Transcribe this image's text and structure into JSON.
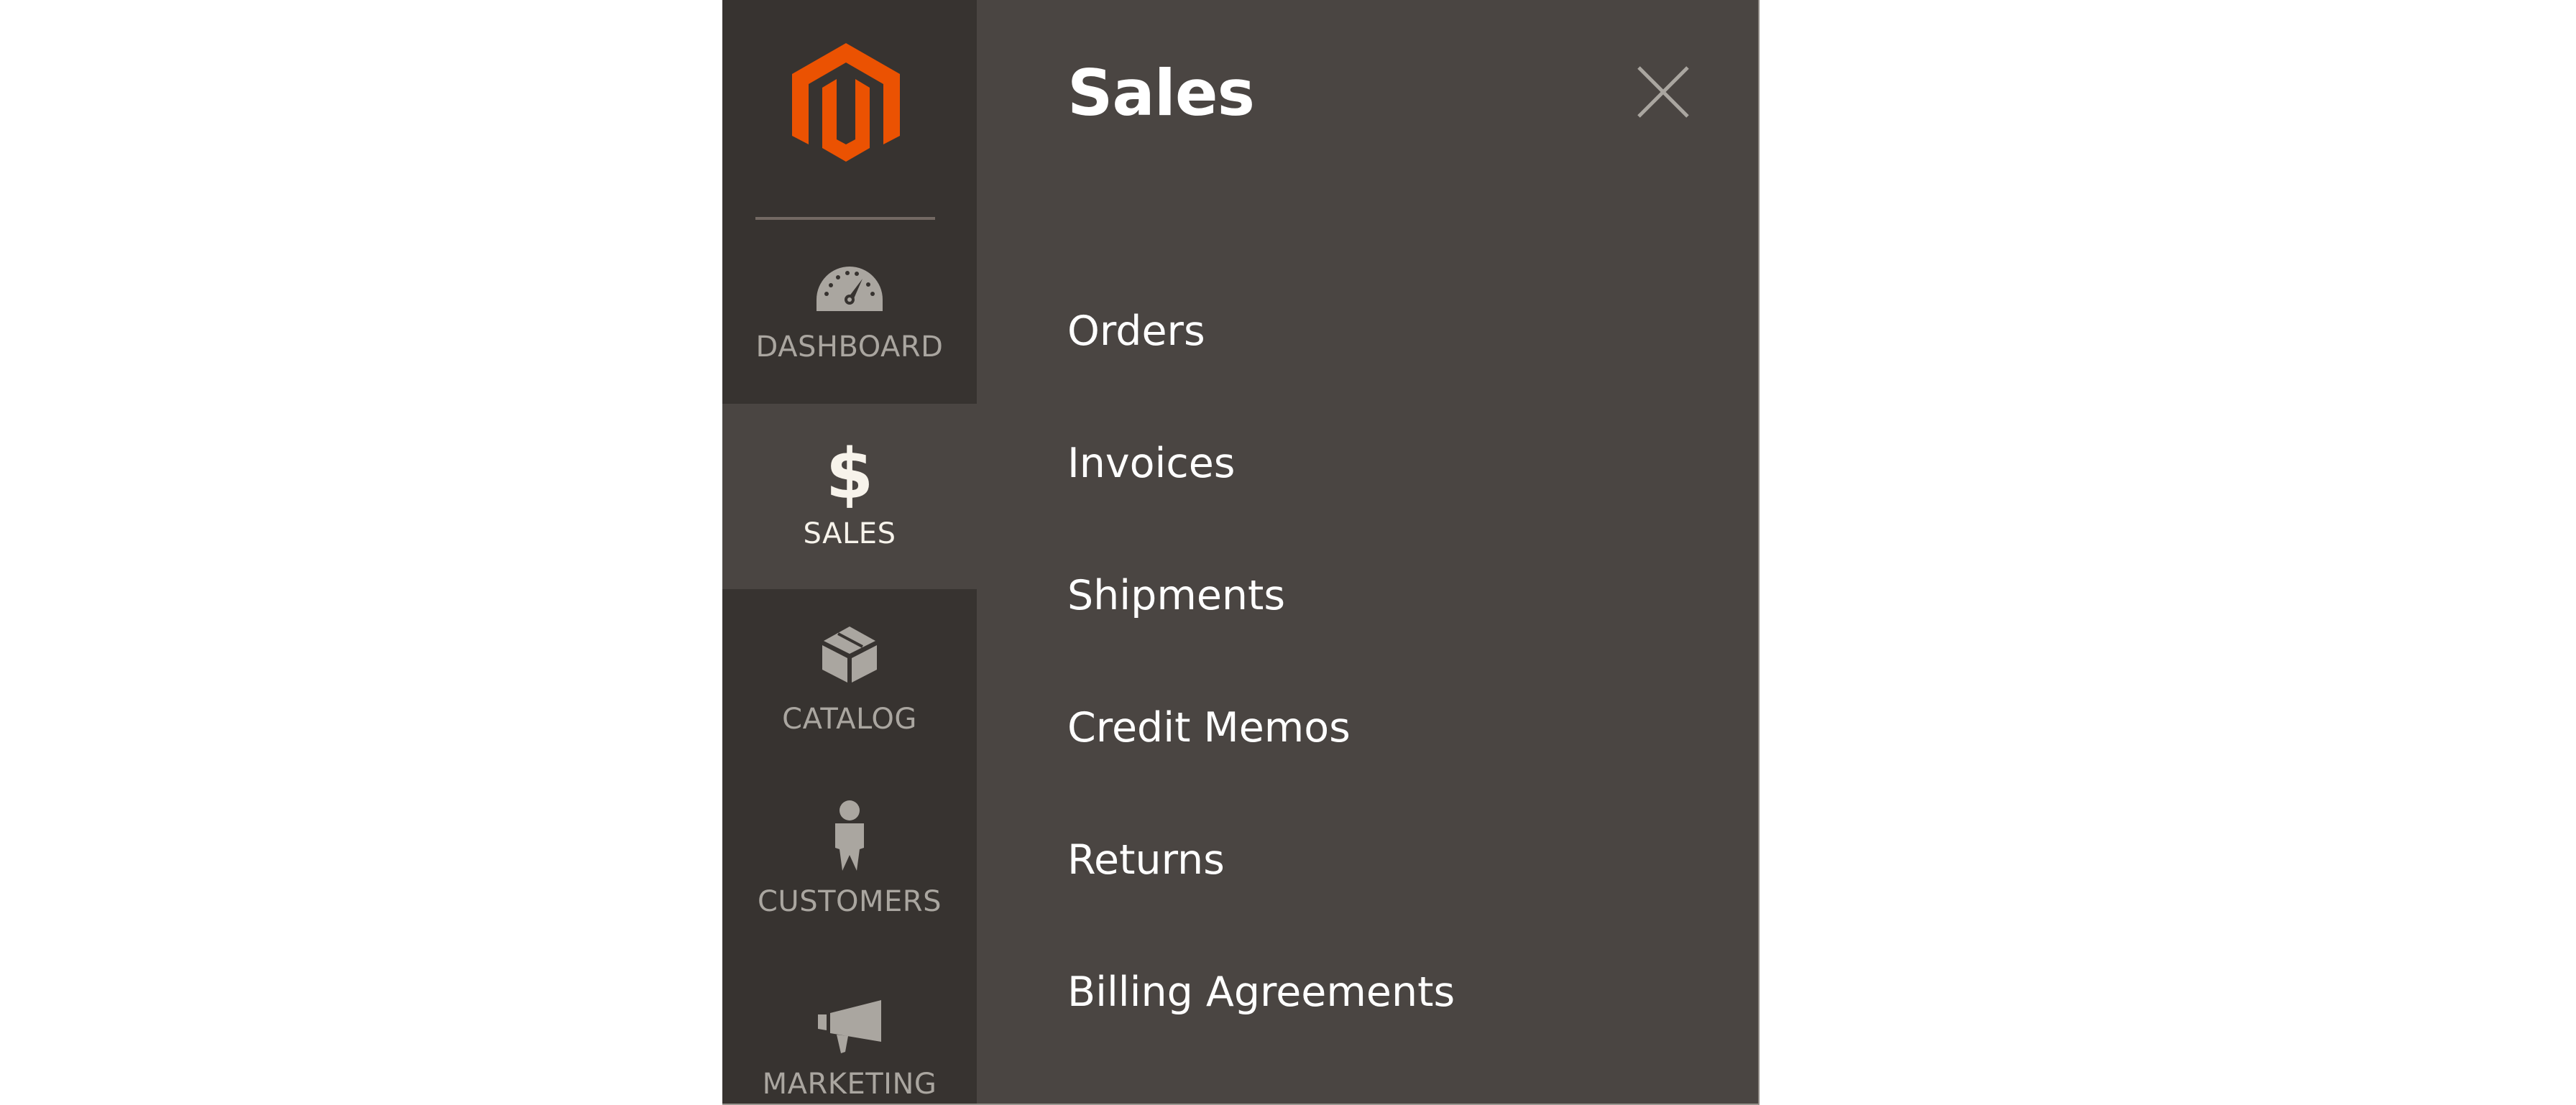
{
  "brand": {
    "logo": "magento-logo",
    "accent_color": "#eb5202"
  },
  "sidebar": {
    "items": [
      {
        "label": "DASHBOARD",
        "icon": "dashboard-gauge-icon",
        "active": false
      },
      {
        "label": "SALES",
        "icon": "dollar-icon",
        "active": true
      },
      {
        "label": "CATALOG",
        "icon": "box-icon",
        "active": false
      },
      {
        "label": "CUSTOMERS",
        "icon": "person-icon",
        "active": false
      },
      {
        "label": "MARKETING",
        "icon": "megaphone-icon",
        "active": false
      }
    ]
  },
  "panel": {
    "title": "Sales",
    "close_icon": "close-icon",
    "items": [
      {
        "label": "Orders"
      },
      {
        "label": "Invoices"
      },
      {
        "label": "Shipments"
      },
      {
        "label": "Credit Memos"
      },
      {
        "label": "Returns"
      },
      {
        "label": "Billing Agreements"
      }
    ]
  },
  "colors": {
    "sidebar_bg": "#373330",
    "panel_bg": "#4a4542",
    "icon_inactive": "#aaa6a0",
    "text_active": "#f7f3eb"
  }
}
